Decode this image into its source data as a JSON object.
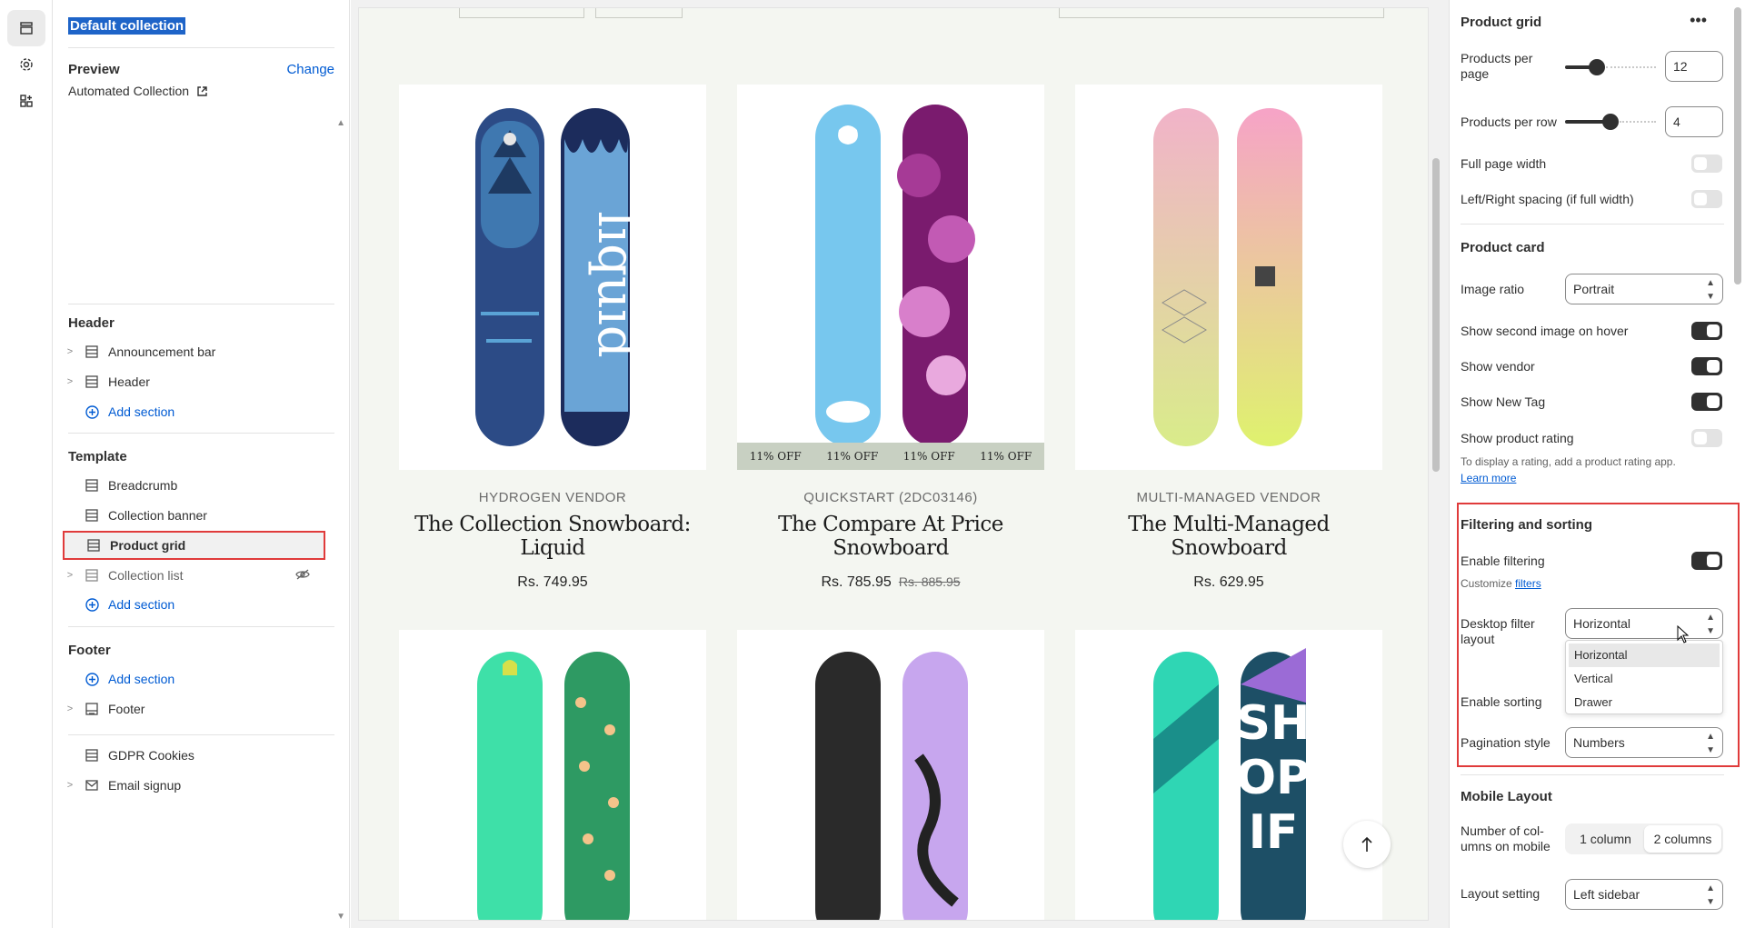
{
  "colors": {
    "accent": "#005bd3",
    "highlight": "#e03b3b",
    "canvas_bg": "#f4f6f1",
    "dark": "#303030"
  },
  "rail": {
    "icons": [
      "sections-icon",
      "settings-gear-icon",
      "apps-icon"
    ]
  },
  "left": {
    "collection_title": "Default collection",
    "preview_label": "Preview",
    "change_label": "Change",
    "preview_value": "Automated Collection",
    "header_group": "Header",
    "header_items": [
      "Announcement bar",
      "Header"
    ],
    "template_group": "Template",
    "template_items": [
      "Breadcrumb",
      "Collection banner",
      "Product grid",
      "Collection list"
    ],
    "footer_group": "Footer",
    "footer_items": [
      "Footer",
      "GDPR Cookies",
      "Email signup"
    ],
    "add_section": "Add section"
  },
  "canvas": {
    "products": [
      {
        "vendor": "HYDROGEN VENDOR",
        "title": "The Collection Snowboard: Liquid",
        "price": "Rs. 749.95",
        "compare": ""
      },
      {
        "vendor": "QUICKSTART (2DC03146)",
        "title": "The Compare At Price Snowboard",
        "price": "Rs. 785.95",
        "compare": "Rs. 885.95",
        "badge": "11% OFF"
      },
      {
        "vendor": "MULTI-MANAGED VENDOR",
        "title": "The Multi-Managed Snowboard",
        "price": "Rs. 629.95",
        "compare": ""
      }
    ]
  },
  "right": {
    "title": "Product grid",
    "products_per_page_label": "Products per page",
    "products_per_page": "12",
    "products_per_page_fraction": 0.35,
    "products_per_row_label": "Products per row",
    "products_per_row": "4",
    "products_per_row_fraction": 0.5,
    "full_page_width_label": "Full page width",
    "full_page_width": false,
    "lr_spacing_label": "Left/Right spacing (if full width)",
    "lr_spacing": false,
    "product_card_section": "Product card",
    "image_ratio_label": "Image ratio",
    "image_ratio": "Portrait",
    "show_second_image_label": "Show second image on hover",
    "show_second_image": true,
    "show_vendor_label": "Show vendor",
    "show_vendor": true,
    "show_new_tag_label": "Show New Tag",
    "show_new_tag": true,
    "show_rating_label": "Show product rating",
    "show_rating": false,
    "rating_help": "To display a rating, add a product rating app.",
    "learn_more": "Learn more",
    "filtering_section": "Filtering and sorting",
    "enable_filtering_label": "Enable filtering",
    "enable_filtering": true,
    "customize_text": "Customize",
    "filters_link": "filters",
    "desktop_filter_label": "Desktop filter layout",
    "desktop_filter_value": "Horizontal",
    "filter_options": [
      "Horizontal",
      "Vertical",
      "Drawer"
    ],
    "enable_sorting_label": "Enable sorting",
    "pagination_label": "Pagination style",
    "pagination_value": "Numbers",
    "mobile_section": "Mobile Layout",
    "columns_mobile_label": "Number of col-umns on mobile",
    "columns_options": [
      "1 column",
      "2 columns"
    ],
    "layout_setting_label": "Layout setting",
    "layout_setting_value": "Left sidebar"
  }
}
